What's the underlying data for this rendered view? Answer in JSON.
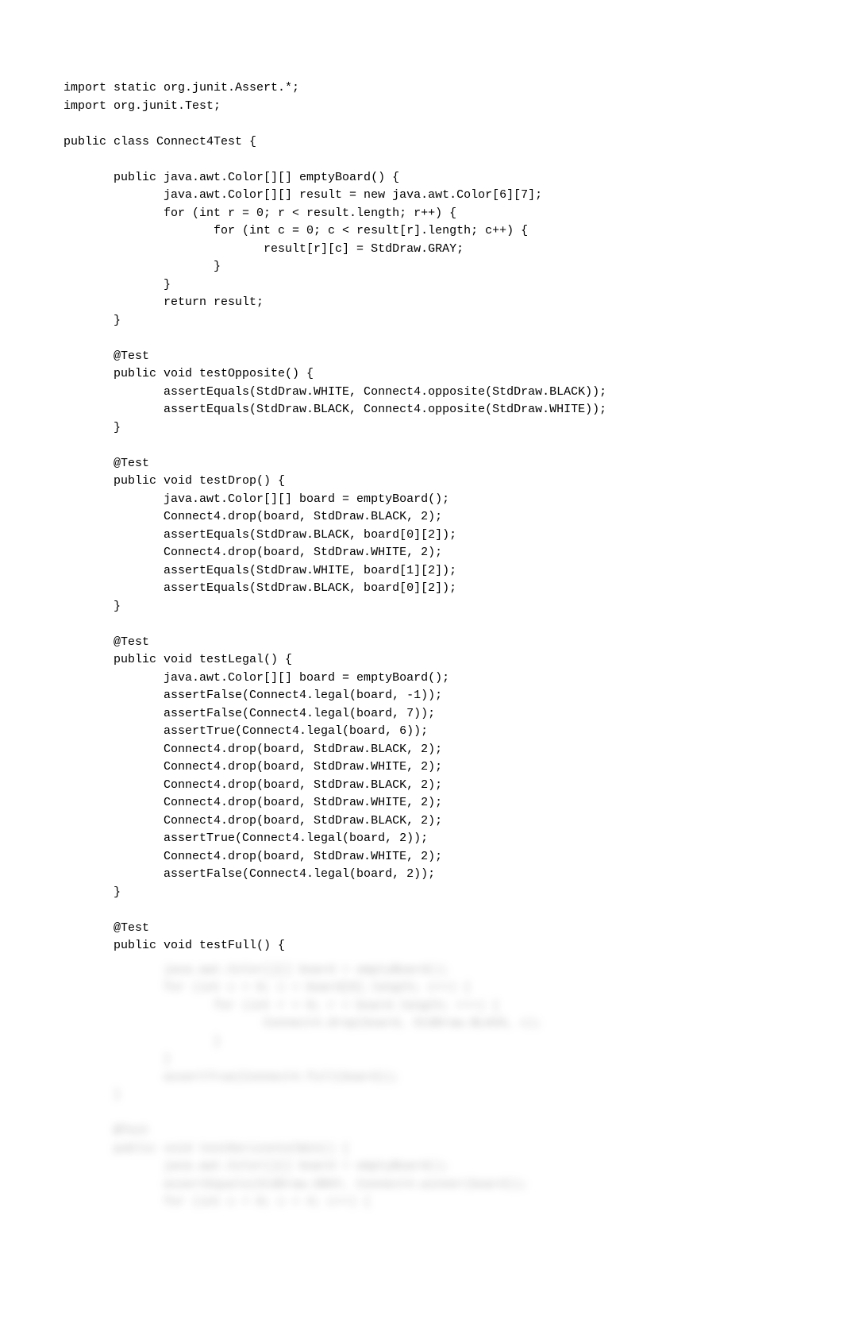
{
  "code": {
    "lines": [
      "import static org.junit.Assert.*;",
      "import org.junit.Test;",
      "",
      "public class Connect4Test {",
      "",
      "       public java.awt.Color[][] emptyBoard() {",
      "              java.awt.Color[][] result = new java.awt.Color[6][7];",
      "              for (int r = 0; r < result.length; r++) {",
      "                     for (int c = 0; c < result[r].length; c++) {",
      "                            result[r][c] = StdDraw.GRAY;",
      "                     }",
      "              }",
      "              return result;",
      "       }",
      "",
      "       @Test",
      "       public void testOpposite() {",
      "              assertEquals(StdDraw.WHITE, Connect4.opposite(StdDraw.BLACK));",
      "              assertEquals(StdDraw.BLACK, Connect4.opposite(StdDraw.WHITE));",
      "       }",
      "",
      "       @Test",
      "       public void testDrop() {",
      "              java.awt.Color[][] board = emptyBoard();",
      "              Connect4.drop(board, StdDraw.BLACK, 2);",
      "              assertEquals(StdDraw.BLACK, board[0][2]);",
      "              Connect4.drop(board, StdDraw.WHITE, 2);",
      "              assertEquals(StdDraw.WHITE, board[1][2]);",
      "              assertEquals(StdDraw.BLACK, board[0][2]);",
      "       }",
      "",
      "       @Test",
      "       public void testLegal() {",
      "              java.awt.Color[][] board = emptyBoard();",
      "              assertFalse(Connect4.legal(board, -1));",
      "              assertFalse(Connect4.legal(board, 7));",
      "              assertTrue(Connect4.legal(board, 6));",
      "              Connect4.drop(board, StdDraw.BLACK, 2);",
      "              Connect4.drop(board, StdDraw.WHITE, 2);",
      "              Connect4.drop(board, StdDraw.BLACK, 2);",
      "              Connect4.drop(board, StdDraw.WHITE, 2);",
      "              Connect4.drop(board, StdDraw.BLACK, 2);",
      "              assertTrue(Connect4.legal(board, 2));",
      "              Connect4.drop(board, StdDraw.WHITE, 2);",
      "              assertFalse(Connect4.legal(board, 2));",
      "       }",
      "",
      "       @Test",
      "       public void testFull() {"
    ],
    "blurred_lines": [
      "              java.awt.Color[][] board = emptyBoard();",
      "              for (int c = 0; c < board[0].length; c++) {",
      "                     for (int r = 0; r < board.length; r++) {",
      "                            Connect4.drop(board, StdDraw.BLACK, c);",
      "                     }",
      "              }",
      "              assertTrue(Connect4.full(board));",
      "       }",
      "",
      "       @Test",
      "       public void testHorizontalWin() {",
      "              java.awt.Color[][] board = emptyBoard();",
      "              assertEquals(StdDraw.GRAY, Connect4.winner(board));",
      "              for (int c = 0; c < 4; c++) {"
    ]
  }
}
